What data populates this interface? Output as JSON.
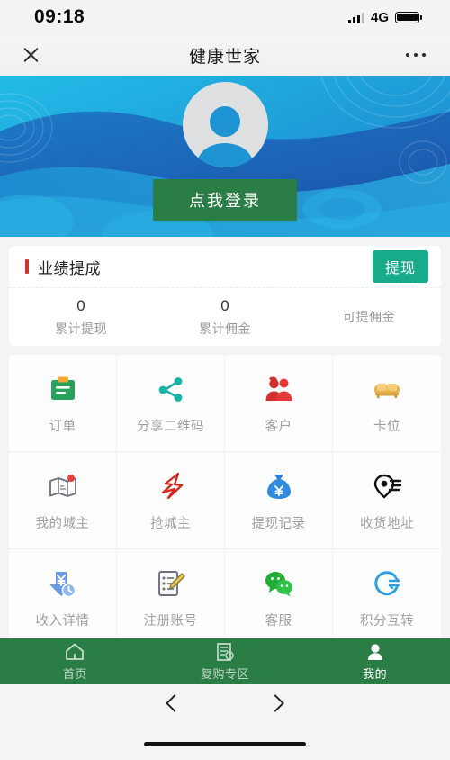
{
  "status_bar": {
    "time": "09:18",
    "network": "4G",
    "signal_icon": "signal-bars-icon",
    "battery_icon": "battery-icon"
  },
  "navbar": {
    "title": "健康世家",
    "close_icon": "close-icon",
    "more_icon": "more-options-icon"
  },
  "hero": {
    "avatar_icon": "avatar-placeholder-icon",
    "login_label": "点我登录"
  },
  "performance_card": {
    "title": "业绩提成",
    "withdraw_label": "提现",
    "stats": [
      {
        "value": "0",
        "label": "累计提现"
      },
      {
        "value": "0",
        "label": "累计佣金"
      },
      {
        "value": "",
        "label": "可提佣金"
      }
    ]
  },
  "menu_grid": [
    {
      "label": "订单",
      "icon": "clipboard-order-icon"
    },
    {
      "label": "分享二维码",
      "icon": "share-qrcode-icon"
    },
    {
      "label": "客户",
      "icon": "customers-icon"
    },
    {
      "label": "卡位",
      "icon": "sofa-seat-icon"
    },
    {
      "label": "我的城主",
      "icon": "my-city-lord-icon"
    },
    {
      "label": "抢城主",
      "icon": "grab-city-lord-icon"
    },
    {
      "label": "提现记录",
      "icon": "money-bag-icon"
    },
    {
      "label": "收货地址",
      "icon": "delivery-address-icon"
    },
    {
      "label": "收入详情",
      "icon": "income-details-icon"
    },
    {
      "label": "注册账号",
      "icon": "register-account-icon"
    },
    {
      "label": "客服",
      "icon": "customer-service-icon"
    },
    {
      "label": "积分互转",
      "icon": "points-transfer-icon"
    }
  ],
  "tabbar": [
    {
      "label": "首页",
      "icon": "home-icon",
      "active": false
    },
    {
      "label": "复购专区",
      "icon": "repurchase-icon",
      "active": false
    },
    {
      "label": "我的",
      "icon": "profile-icon",
      "active": true
    }
  ],
  "browser_bar": {
    "back_icon": "chevron-left-icon",
    "forward_icon": "chevron-right-icon",
    "home_indicator": "home-indicator"
  },
  "colors": {
    "brand_green": "#2a7d44",
    "teal_button": "#18ab8a",
    "accent_red": "#d0342c",
    "hero_blue": "#1b8fd0"
  }
}
